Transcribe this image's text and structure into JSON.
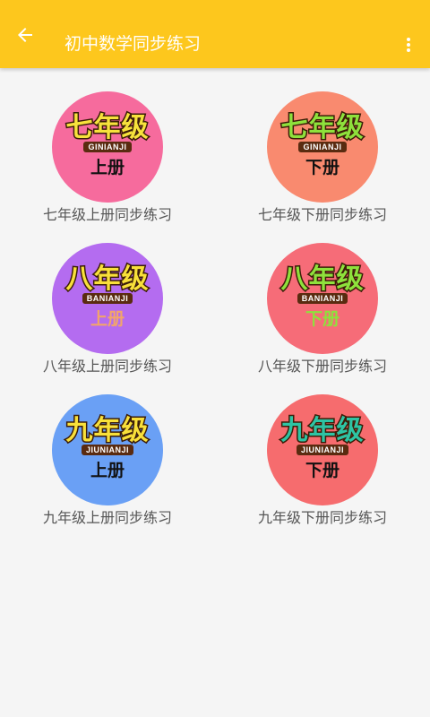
{
  "appbar": {
    "title": "初中数学同步练习",
    "back_icon": "arrow-back-icon",
    "more_icon": "more-vert-icon",
    "color": "#fdc71d"
  },
  "tiles": [
    {
      "grade": "七年级",
      "pinyin": "GINIANJI",
      "volume": "上册",
      "label": "七年级上册同步练习",
      "bg": "#f66b9d",
      "title_color": "#f7e23c",
      "volume_color": "#111111"
    },
    {
      "grade": "七年级",
      "pinyin": "GINIANJI",
      "volume": "下册",
      "label": "七年级下册同步练习",
      "bg": "#f98a6f",
      "title_color": "#8ee13c",
      "volume_color": "#111111"
    },
    {
      "grade": "八年级",
      "pinyin": "BANIANJI",
      "volume": "上册",
      "label": "八年级上册同步练习",
      "bg": "#b46cf0",
      "title_color": "#f8e03a",
      "volume_color": "#f2a56a"
    },
    {
      "grade": "八年级",
      "pinyin": "BANIANJI",
      "volume": "下册",
      "label": "八年级下册同步练习",
      "bg": "#f66c78",
      "title_color": "#8ee13c",
      "volume_color": "#8ee13c"
    },
    {
      "grade": "九年级",
      "pinyin": "JIUNIANJI",
      "volume": "上册",
      "label": "九年级上册同步练习",
      "bg": "#6aa0f5",
      "title_color": "#f8e03a",
      "volume_color": "#111111"
    },
    {
      "grade": "九年级",
      "pinyin": "JIUNIANJI",
      "volume": "下册",
      "label": "九年级下册同步练习",
      "bg": "#f66c6e",
      "title_color": "#2ec4a4",
      "volume_color": "#111111"
    }
  ]
}
